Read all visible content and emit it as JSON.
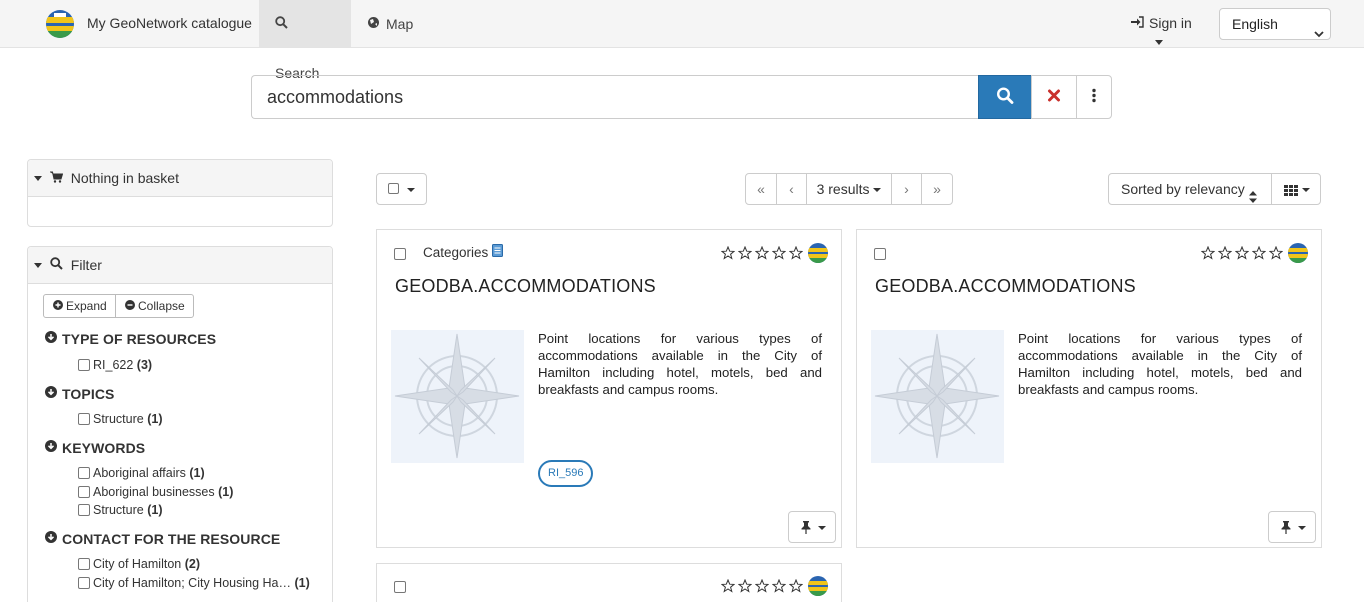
{
  "nav": {
    "brand": "My GeoNetwork catalogue",
    "search_label": "Search",
    "map_label": "Map",
    "signin_label": "Sign in",
    "language": "English"
  },
  "search": {
    "query": "accommodations"
  },
  "basket": {
    "title": "Nothing in basket"
  },
  "filter": {
    "title": "Filter",
    "expand_label": "Expand",
    "collapse_label": "Collapse",
    "groups": [
      {
        "title": "TYPE OF RESOURCES",
        "items": [
          {
            "label": "RI_622",
            "count": "(3)"
          }
        ]
      },
      {
        "title": "TOPICS",
        "items": [
          {
            "label": "Structure",
            "count": "(1)"
          }
        ]
      },
      {
        "title": "KEYWORDS",
        "items": [
          {
            "label": "Aboriginal affairs",
            "count": "(1)"
          },
          {
            "label": "Aboriginal businesses",
            "count": "(1)"
          },
          {
            "label": "Structure",
            "count": "(1)"
          }
        ]
      },
      {
        "title": "CONTACT FOR THE RESOURCE",
        "items": [
          {
            "label": "City of Hamilton",
            "count": "(2)"
          },
          {
            "label": "City of Hamilton; City Housing Ha…",
            "count": "(1)"
          }
        ]
      }
    ]
  },
  "toolbar": {
    "results_label": "3 results",
    "sort_label": "Sorted by relevancy",
    "first_symbol": "«",
    "prev_symbol": "‹",
    "next_symbol": "›",
    "last_symbol": "»"
  },
  "results": [
    {
      "categories_label": "Categories",
      "title": "GEODBA.ACCOMMODATIONS",
      "description": "Point locations for various types of accommodations available in the City of Hamilton including hotel, motels, bed and breakfasts and campus rooms.",
      "tag": "RI_596"
    },
    {
      "title": "GEODBA.ACCOMMODATIONS",
      "description": "Point locations for various types of accommodations available in the City of Hamilton including hotel, motels, bed and breakfasts and campus rooms."
    }
  ],
  "icons": {
    "search": "search-icon",
    "map": "globe-icon",
    "signin": "sign-in-icon",
    "clear": "close-icon",
    "more": "ellipsis-vertical-icon",
    "basket": "cart-icon",
    "pin": "pin-icon",
    "view": "grid-icon",
    "star": "star-outline-icon"
  },
  "colors": {
    "primary": "#2a7ab8",
    "clear": "#c9302c"
  }
}
